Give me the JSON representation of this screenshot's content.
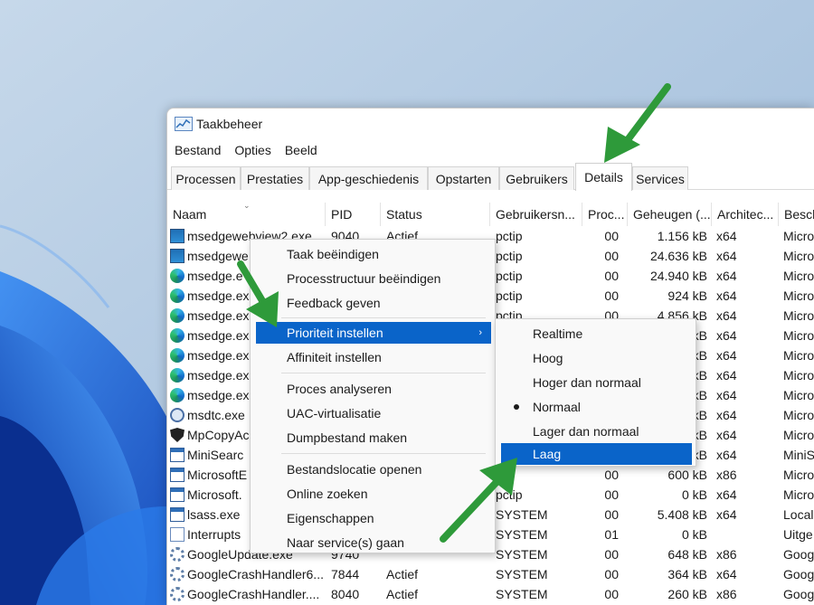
{
  "window": {
    "title": "Taakbeheer"
  },
  "menu": [
    "Bestand",
    "Opties",
    "Beeld"
  ],
  "tabs": [
    "Processen",
    "Prestaties",
    "App-geschiedenis",
    "Opstarten",
    "Gebruikers",
    "Details",
    "Services"
  ],
  "active_tab": "Details",
  "columns": [
    "Naam",
    "PID",
    "Status",
    "Gebruikersn...",
    "Proc...",
    "Geheugen (...",
    "Architec...",
    "Besch"
  ],
  "rows": [
    {
      "icon": "webview-icon",
      "name": "msedgewebview2.exe",
      "pid": "9040",
      "status": "Actief",
      "user": "pctip",
      "cpu": "00",
      "mem": "1.156 kB",
      "arch": "x64",
      "desc": "Micro"
    },
    {
      "icon": "webview-icon",
      "name": "msedgewe",
      "pid": "",
      "status": "",
      "user": "pctip",
      "cpu": "00",
      "mem": "24.636 kB",
      "arch": "x64",
      "desc": "Micro"
    },
    {
      "icon": "edge-icon",
      "name": "msedge.e",
      "pid": "",
      "status": "",
      "user": "pctip",
      "cpu": "00",
      "mem": "24.940 kB",
      "arch": "x64",
      "desc": "Micro"
    },
    {
      "icon": "edge-icon",
      "name": "msedge.ex",
      "pid": "",
      "status": "",
      "user": "pctip",
      "cpu": "00",
      "mem": "924 kB",
      "arch": "x64",
      "desc": "Micro"
    },
    {
      "icon": "edge-icon",
      "name": "msedge.ex",
      "pid": "",
      "status": "",
      "user": "pctip",
      "cpu": "00",
      "mem": "4.856 kB",
      "arch": "x64",
      "desc": "Micro"
    },
    {
      "icon": "edge-icon",
      "name": "msedge.ex",
      "pid": "",
      "status": "",
      "user": "",
      "cpu": "",
      "mem": "kB",
      "arch": "x64",
      "desc": "Micro"
    },
    {
      "icon": "edge-icon",
      "name": "msedge.ex",
      "pid": "",
      "status": "",
      "user": "",
      "cpu": "",
      "mem": "kB",
      "arch": "x64",
      "desc": "Micro"
    },
    {
      "icon": "edge-icon",
      "name": "msedge.ex",
      "pid": "",
      "status": "",
      "user": "",
      "cpu": "",
      "mem": "kB",
      "arch": "x64",
      "desc": "Micro"
    },
    {
      "icon": "edge-icon",
      "name": "msedge.ex",
      "pid": "",
      "status": "",
      "user": "",
      "cpu": "",
      "mem": "kB",
      "arch": "x64",
      "desc": "Micro"
    },
    {
      "icon": "dtc-icon",
      "name": "msdtc.exe",
      "pid": "",
      "status": "",
      "user": "",
      "cpu": "",
      "mem": "kB",
      "arch": "x64",
      "desc": "Micro"
    },
    {
      "icon": "shield-icon",
      "name": "MpCopyAc",
      "pid": "",
      "status": "",
      "user": "",
      "cpu": "",
      "mem": "kB",
      "arch": "x64",
      "desc": "Micro"
    },
    {
      "icon": "window-icon",
      "name": "MiniSearc",
      "pid": "",
      "status": "",
      "user": "",
      "cpu": "",
      "mem": "kB",
      "arch": "x64",
      "desc": "MiniS"
    },
    {
      "icon": "window-icon",
      "name": "MicrosoftE",
      "pid": "",
      "status": "",
      "user": "",
      "cpu": "00",
      "mem": "600 kB",
      "arch": "x86",
      "desc": "Micro"
    },
    {
      "icon": "window-icon",
      "name": "Microsoft.",
      "pid": "",
      "status": "",
      "user": "pctip",
      "cpu": "00",
      "mem": "0 kB",
      "arch": "x64",
      "desc": "Micro"
    },
    {
      "icon": "window-icon",
      "name": "lsass.exe",
      "pid": "",
      "status": "",
      "user": "SYSTEM",
      "cpu": "00",
      "mem": "5.408 kB",
      "arch": "x64",
      "desc": "Local"
    },
    {
      "icon": "blank-icon",
      "name": "Interrupts",
      "pid": "",
      "status": "",
      "user": "SYSTEM",
      "cpu": "01",
      "mem": "0 kB",
      "arch": "",
      "desc": "Uitge"
    },
    {
      "icon": "gear-icon",
      "name": "GoogleUpdate.exe",
      "pid": "9740",
      "status": "",
      "user": "SYSTEM",
      "cpu": "00",
      "mem": "648 kB",
      "arch": "x86",
      "desc": "Goog"
    },
    {
      "icon": "gear-icon",
      "name": "GoogleCrashHandler6...",
      "pid": "7844",
      "status": "Actief",
      "user": "SYSTEM",
      "cpu": "00",
      "mem": "364 kB",
      "arch": "x64",
      "desc": "Goog"
    },
    {
      "icon": "gear-icon",
      "name": "GoogleCrashHandler....",
      "pid": "8040",
      "status": "Actief",
      "user": "SYSTEM",
      "cpu": "00",
      "mem": "260 kB",
      "arch": "x86",
      "desc": "Goog"
    }
  ],
  "context_menu": {
    "items": [
      {
        "label": "Taak beëindigen"
      },
      {
        "label": "Processtructuur beëindigen"
      },
      {
        "label": "Feedback geven"
      },
      {
        "label": "Prioriteit instellen",
        "highlighted": true,
        "submenu": true
      },
      {
        "label": "Affiniteit instellen"
      },
      {
        "label": "Proces analyseren"
      },
      {
        "label": "UAC-virtualisatie"
      },
      {
        "label": "Dumpbestand maken"
      },
      {
        "label": "Bestandslocatie openen"
      },
      {
        "label": "Online zoeken"
      },
      {
        "label": "Eigenschappen"
      },
      {
        "label": "Naar service(s) gaan"
      }
    ]
  },
  "priority_submenu": {
    "items": [
      {
        "label": "Realtime"
      },
      {
        "label": "Hoog"
      },
      {
        "label": "Hoger dan normaal"
      },
      {
        "label": "Normaal",
        "selected": true
      },
      {
        "label": "Lager dan normaal"
      },
      {
        "label": "Laag",
        "highlighted": true
      }
    ]
  },
  "colors": {
    "accent": "#0a64c9",
    "arrow": "#2e9a3a",
    "desktop_bg": "#a9c3de",
    "bloom": "#1f63d6"
  }
}
